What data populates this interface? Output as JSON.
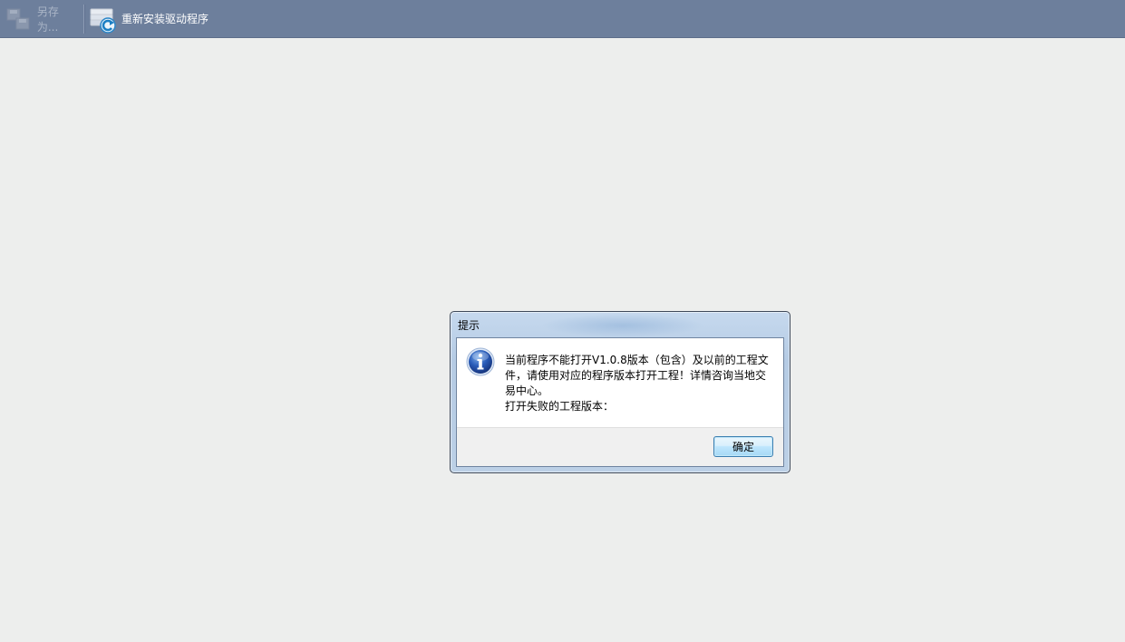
{
  "toolbar": {
    "save_as": {
      "label": "另存为...",
      "icon": "save-as-icon",
      "enabled": false
    },
    "reinstall_driver": {
      "label": "重新安装驱动程序",
      "icon": "reinstall-driver-icon"
    }
  },
  "dialog": {
    "title": "提示",
    "icon": "info-icon",
    "message": "当前程序不能打开V1.0.8版本（包含）及以前的工程文件，请使用对应的程序版本打开工程！详情咨询当地交易中心。\n打开失败的工程版本：",
    "ok_label": "确定"
  },
  "colors": {
    "toolbar_bg": "#6d7f9c",
    "workspace_bg": "#edeeed",
    "dialog_frame": "#bcd0e6",
    "info_icon_blue": "#1f4fa8"
  }
}
